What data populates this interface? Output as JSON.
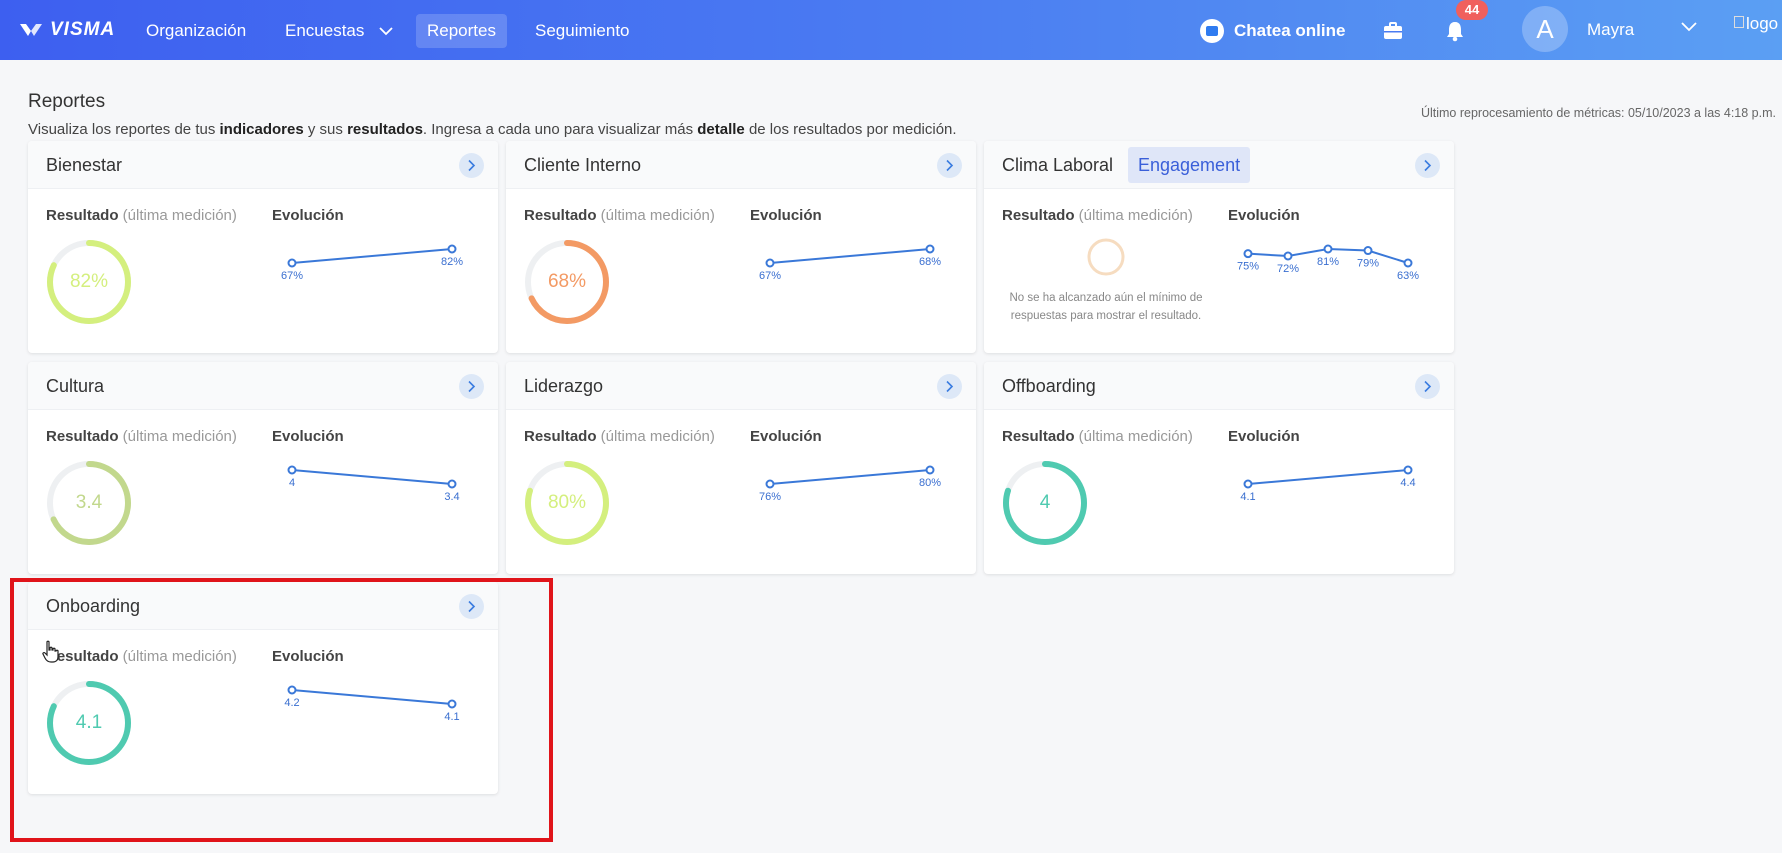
{
  "nav": {
    "brand": "VISMA",
    "items": [
      {
        "label": "Organización"
      },
      {
        "label": "Encuestas"
      },
      {
        "label": "Reportes"
      },
      {
        "label": "Seguimiento"
      }
    ],
    "chat_label": "Chatea online",
    "notifications_count": "44",
    "avatar_letter": "A",
    "user_name": "Mayra",
    "logo_alt": "logo"
  },
  "page": {
    "title": "Reportes",
    "desc_1": "Visualiza los reportes de tus ",
    "desc_b1": "indicadores",
    "desc_2": " y sus ",
    "desc_b2": "resultados",
    "desc_3": ". Ingresa a cada uno para visualizar más ",
    "desc_b3": "detalle",
    "desc_4": " de los resultados por medición.",
    "reprocess": "Último reprocesamiento de métricas: 05/10/2023 a las 4:18 p.m."
  },
  "labels": {
    "result": "Resultado",
    "result_sub": " (última medición)",
    "evolution": "Evolución",
    "no_data": "No se ha alcanzado aún el mínimo de respuestas para mostrar el resultado."
  },
  "cards": [
    {
      "title": "Bienestar",
      "value": "82%",
      "fraction": 0.82,
      "color": "#d4ef7e",
      "evo_values": [
        "67%",
        "82%"
      ],
      "evo_levels": [
        67,
        82
      ]
    },
    {
      "title": "Cliente Interno",
      "value": "68%",
      "fraction": 0.68,
      "color": "#f39a64",
      "evo_values": [
        "67%",
        "68%"
      ],
      "evo_levels": [
        67,
        68
      ]
    },
    {
      "title": "Clima Laboral",
      "tag": "Engagement",
      "value": "",
      "no_data": true,
      "color": "#f6dcc0",
      "evo_values": [
        "75%",
        "72%",
        "81%",
        "79%",
        "63%"
      ],
      "evo_levels": [
        75,
        72,
        81,
        79,
        63
      ]
    },
    {
      "title": "Cultura",
      "value": "3.4",
      "fraction": 0.68,
      "color": "#c2d88d",
      "evo_values": [
        "4",
        "3.4"
      ],
      "evo_levels": [
        4,
        3.4
      ]
    },
    {
      "title": "Liderazgo",
      "value": "80%",
      "fraction": 0.8,
      "color": "#d4ef7e",
      "evo_values": [
        "76%",
        "80%"
      ],
      "evo_levels": [
        76,
        80
      ]
    },
    {
      "title": "Offboarding",
      "value": "4",
      "fraction": 0.8,
      "color": "#4fcab0",
      "evo_values": [
        "4.1",
        "4.4"
      ],
      "evo_levels": [
        4.1,
        4.4
      ]
    },
    {
      "title": "Onboarding",
      "value": "4.1",
      "fraction": 0.82,
      "color": "#4fcab0",
      "evo_values": [
        "4.2",
        "4.1"
      ],
      "evo_levels": [
        4.2,
        4.1
      ]
    }
  ]
}
